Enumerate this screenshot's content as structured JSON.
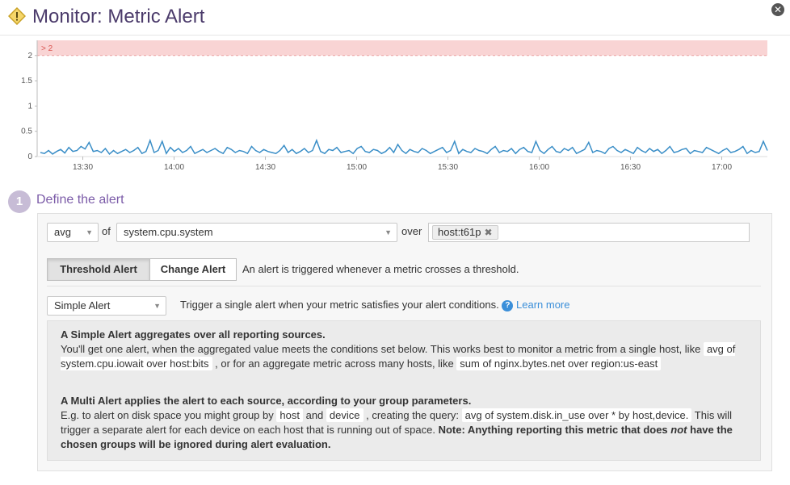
{
  "header": {
    "title": "Monitor: Metric Alert",
    "icons": {
      "warning": "warning-icon",
      "close": "close-icon"
    }
  },
  "chart_data": {
    "type": "line",
    "title": "",
    "xlabel": "",
    "ylabel": "",
    "yticks": [
      "0",
      "0.5",
      "1",
      "1.5",
      "2"
    ],
    "xticks": [
      "13:30",
      "14:00",
      "14:30",
      "15:00",
      "15:30",
      "16:00",
      "16:30",
      "17:00"
    ],
    "ylim": [
      0,
      2.3
    ],
    "threshold": {
      "label": "> 2",
      "value": 2,
      "color": "#f9d4d4"
    },
    "series": [
      {
        "color": "#3a8ec7",
        "x_range": [
          "13:15",
          "17:15"
        ],
        "values": [
          0.08,
          0.06,
          0.12,
          0.05,
          0.1,
          0.14,
          0.07,
          0.18,
          0.1,
          0.12,
          0.2,
          0.15,
          0.28,
          0.1,
          0.12,
          0.08,
          0.16,
          0.05,
          0.12,
          0.06,
          0.1,
          0.14,
          0.08,
          0.12,
          0.18,
          0.06,
          0.1,
          0.32,
          0.08,
          0.12,
          0.3,
          0.06,
          0.18,
          0.1,
          0.16,
          0.08,
          0.12,
          0.2,
          0.06,
          0.1,
          0.14,
          0.08,
          0.12,
          0.16,
          0.1,
          0.06,
          0.18,
          0.14,
          0.08,
          0.12,
          0.1,
          0.06,
          0.2,
          0.12,
          0.08,
          0.14,
          0.1,
          0.08,
          0.06,
          0.12,
          0.22,
          0.08,
          0.14,
          0.06,
          0.1,
          0.16,
          0.08,
          0.12,
          0.32,
          0.1,
          0.06,
          0.14,
          0.12,
          0.18,
          0.08,
          0.1,
          0.12,
          0.06,
          0.16,
          0.2,
          0.1,
          0.08,
          0.14,
          0.12,
          0.06,
          0.1,
          0.18,
          0.08,
          0.24,
          0.12,
          0.06,
          0.14,
          0.1,
          0.08,
          0.16,
          0.12,
          0.06,
          0.1,
          0.14,
          0.18,
          0.08,
          0.12,
          0.3,
          0.06,
          0.14,
          0.1,
          0.08,
          0.16,
          0.12,
          0.1,
          0.06,
          0.14,
          0.2,
          0.08,
          0.12,
          0.1,
          0.16,
          0.06,
          0.14,
          0.18,
          0.1,
          0.08,
          0.3,
          0.12,
          0.06,
          0.14,
          0.2,
          0.1,
          0.08,
          0.16,
          0.12,
          0.18,
          0.06,
          0.1,
          0.14,
          0.28,
          0.08,
          0.12,
          0.1,
          0.06,
          0.16,
          0.2,
          0.12,
          0.08,
          0.14,
          0.1,
          0.06,
          0.18,
          0.12,
          0.08,
          0.16,
          0.1,
          0.14,
          0.06,
          0.12,
          0.2,
          0.08,
          0.1,
          0.14,
          0.16,
          0.06,
          0.12,
          0.1,
          0.08,
          0.18,
          0.14,
          0.1,
          0.06,
          0.12,
          0.16,
          0.08,
          0.1,
          0.14,
          0.2,
          0.06,
          0.12,
          0.08,
          0.1,
          0.3,
          0.12
        ]
      }
    ]
  },
  "section": {
    "step_number": "1",
    "title": "Define the alert"
  },
  "query": {
    "aggregation": "avg",
    "of_label": "of",
    "metric": "system.cpu.system",
    "over_label": "over",
    "scope_tag": "host:t61p"
  },
  "alert_type": {
    "threshold_label": "Threshold Alert",
    "change_label": "Change Alert",
    "description": "An alert is triggered whenever a metric crosses a threshold."
  },
  "alert_mode": {
    "selected": "Simple Alert",
    "description": "Trigger a single alert when your metric satisfies your alert conditions.",
    "learn_more": "Learn more"
  },
  "info": {
    "simple_heading": "A Simple Alert aggregates over all reporting sources.",
    "simple_text_1": "You'll get one alert, when the aggregated value meets the conditions set below. This works best to monitor a metric from a single host, like",
    "simple_code_1": "avg of system.cpu.iowait over host:bits",
    "simple_text_2": ", or for an aggregate metric across many hosts, like",
    "simple_code_2": "sum of nginx.bytes.net over region:us-east",
    "multi_heading": "A Multi Alert applies the alert to each source, according to your group parameters.",
    "multi_text_1": "E.g. to alert on disk space you might group by",
    "multi_code_1": "host",
    "multi_text_2": "and",
    "multi_code_2": "device",
    "multi_text_3": ", creating the query:",
    "multi_code_3": "avg of system.disk.in_use over * by host,device.",
    "multi_text_4": "This will trigger a separate alert for each device on each host that is running out of space.",
    "multi_note_1": "Note: Anything reporting this metric that does",
    "multi_note_em": "not",
    "multi_note_2": "have the chosen groups will be ignored during alert evaluation."
  }
}
